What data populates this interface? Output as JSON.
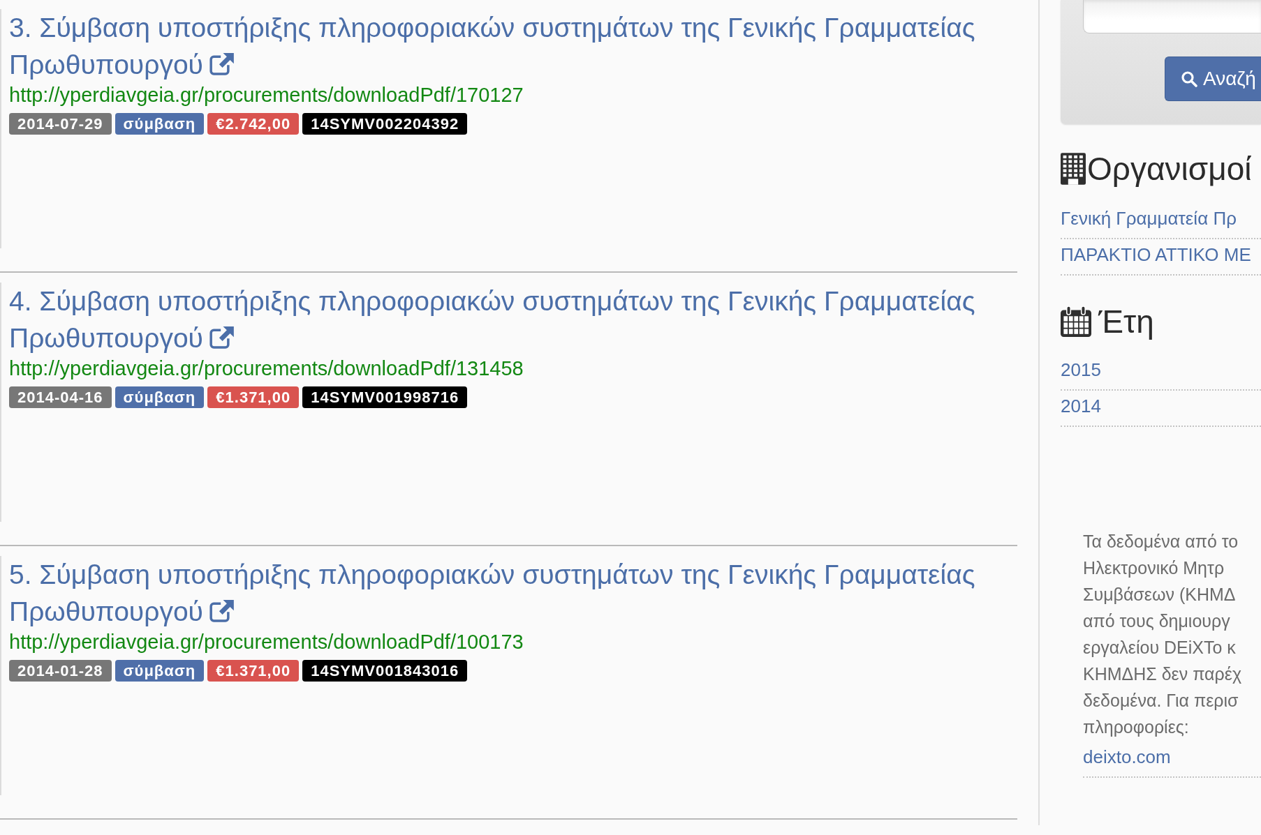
{
  "results": [
    {
      "title": "3. Σύμβαση υποστήριξης πληροφοριακών συστημάτων της Γενικής Γραμματείας Πρωθυπουργού",
      "url": "http://yperdiavgeia.gr/procurements/downloadPdf/170127",
      "badges": [
        {
          "kind": "date",
          "text": "2014-07-29"
        },
        {
          "kind": "type",
          "text": "σύμβαση"
        },
        {
          "kind": "amount",
          "text": "€2.742,00"
        },
        {
          "kind": "code",
          "text": "14SYMV002204392"
        }
      ]
    },
    {
      "title": "4. Σύμβαση υποστήριξης πληροφοριακών συστημάτων της Γενικής Γραμματείας Πρωθυπουργού",
      "url": "http://yperdiavgeia.gr/procurements/downloadPdf/131458",
      "badges": [
        {
          "kind": "date",
          "text": "2014-04-16"
        },
        {
          "kind": "type",
          "text": "σύμβαση"
        },
        {
          "kind": "amount",
          "text": "€1.371,00"
        },
        {
          "kind": "code",
          "text": "14SYMV001998716"
        }
      ]
    },
    {
      "title": "5. Σύμβαση υποστήριξης πληροφοριακών συστημάτων της Γενικής Γραμματείας Πρωθυπουργού",
      "url": "http://yperdiavgeia.gr/procurements/downloadPdf/100173",
      "badges": [
        {
          "kind": "date",
          "text": "2014-01-28"
        },
        {
          "kind": "type",
          "text": "σύμβαση"
        },
        {
          "kind": "amount",
          "text": "€1.371,00"
        },
        {
          "kind": "code",
          "text": "14SYMV001843016"
        }
      ]
    }
  ],
  "sidebar": {
    "search": {
      "button": "Αναζή"
    },
    "organizations": {
      "heading": "Οργανισμοί",
      "items": [
        "Γενική Γραμματεία Πρ",
        "ΠΑΡΑΚΤΙΟ ΑΤΤΙΚΟ ΜΕ"
      ]
    },
    "years": {
      "heading": "Έτη",
      "items": [
        "2015",
        "2014"
      ]
    },
    "note": {
      "lines": [
        "Τα δεδομένα από το",
        "Ηλεκτρονικό Μητρ",
        "Συμβάσεων (ΚΗΜΔ",
        "από τους δημιουργ",
        "εργαλείου DEiXTo κ",
        "ΚΗΜΔΗΣ δεν παρέχ",
        "δεδομένα. Για περισ",
        "πληροφορίες:"
      ],
      "link": "deixto.com"
    }
  }
}
